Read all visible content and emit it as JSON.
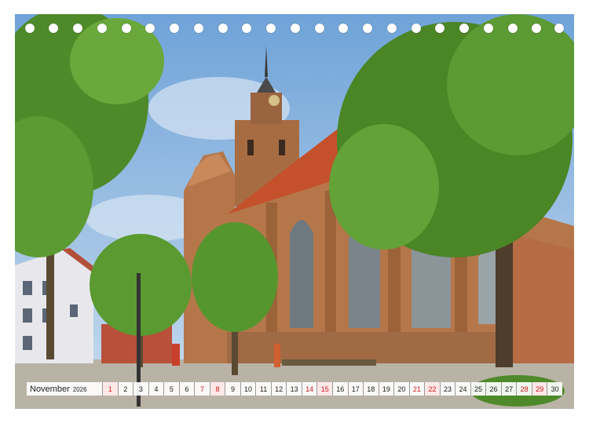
{
  "calendar": {
    "month": "November",
    "year": "2026",
    "days": [
      "1",
      "2",
      "3",
      "4",
      "5",
      "6",
      "7",
      "8",
      "9",
      "10",
      "11",
      "12",
      "13",
      "14",
      "15",
      "16",
      "17",
      "18",
      "19",
      "20",
      "21",
      "22",
      "23",
      "24",
      "25",
      "26",
      "27",
      "28",
      "29",
      "30"
    ],
    "weekend_days": [
      "1",
      "7",
      "8",
      "14",
      "15",
      "21",
      "22",
      "28",
      "29"
    ],
    "weekend_color": "#d01818"
  },
  "colors": {
    "sky": "#7fb0e0",
    "brick": "#b5774a",
    "roof": "#c4502c",
    "foliage": "#4f8a2a"
  }
}
